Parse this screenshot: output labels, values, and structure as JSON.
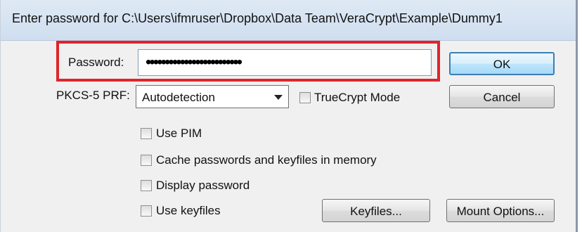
{
  "dialog": {
    "title": "Enter password for C:\\Users\\ifmruser\\Dropbox\\Data Team\\VeraCrypt\\Example\\Dummy1"
  },
  "password": {
    "label": "Password:",
    "masked_value": "•••••••••••••••••••••••••"
  },
  "prf": {
    "label": "PKCS-5 PRF:",
    "selected": "Autodetection"
  },
  "options": {
    "truecrypt_mode": "TrueCrypt Mode",
    "use_pim": "Use PIM",
    "cache": "Cache passwords and keyfiles in memory",
    "display_password": "Display password",
    "use_keyfiles": "Use keyfiles"
  },
  "buttons": {
    "ok": "OK",
    "cancel": "Cancel",
    "keyfiles": "Keyfiles...",
    "mount_options": "Mount Options..."
  },
  "colors": {
    "highlight": "#e0242c",
    "default_button_border": "#3c7fb1"
  }
}
